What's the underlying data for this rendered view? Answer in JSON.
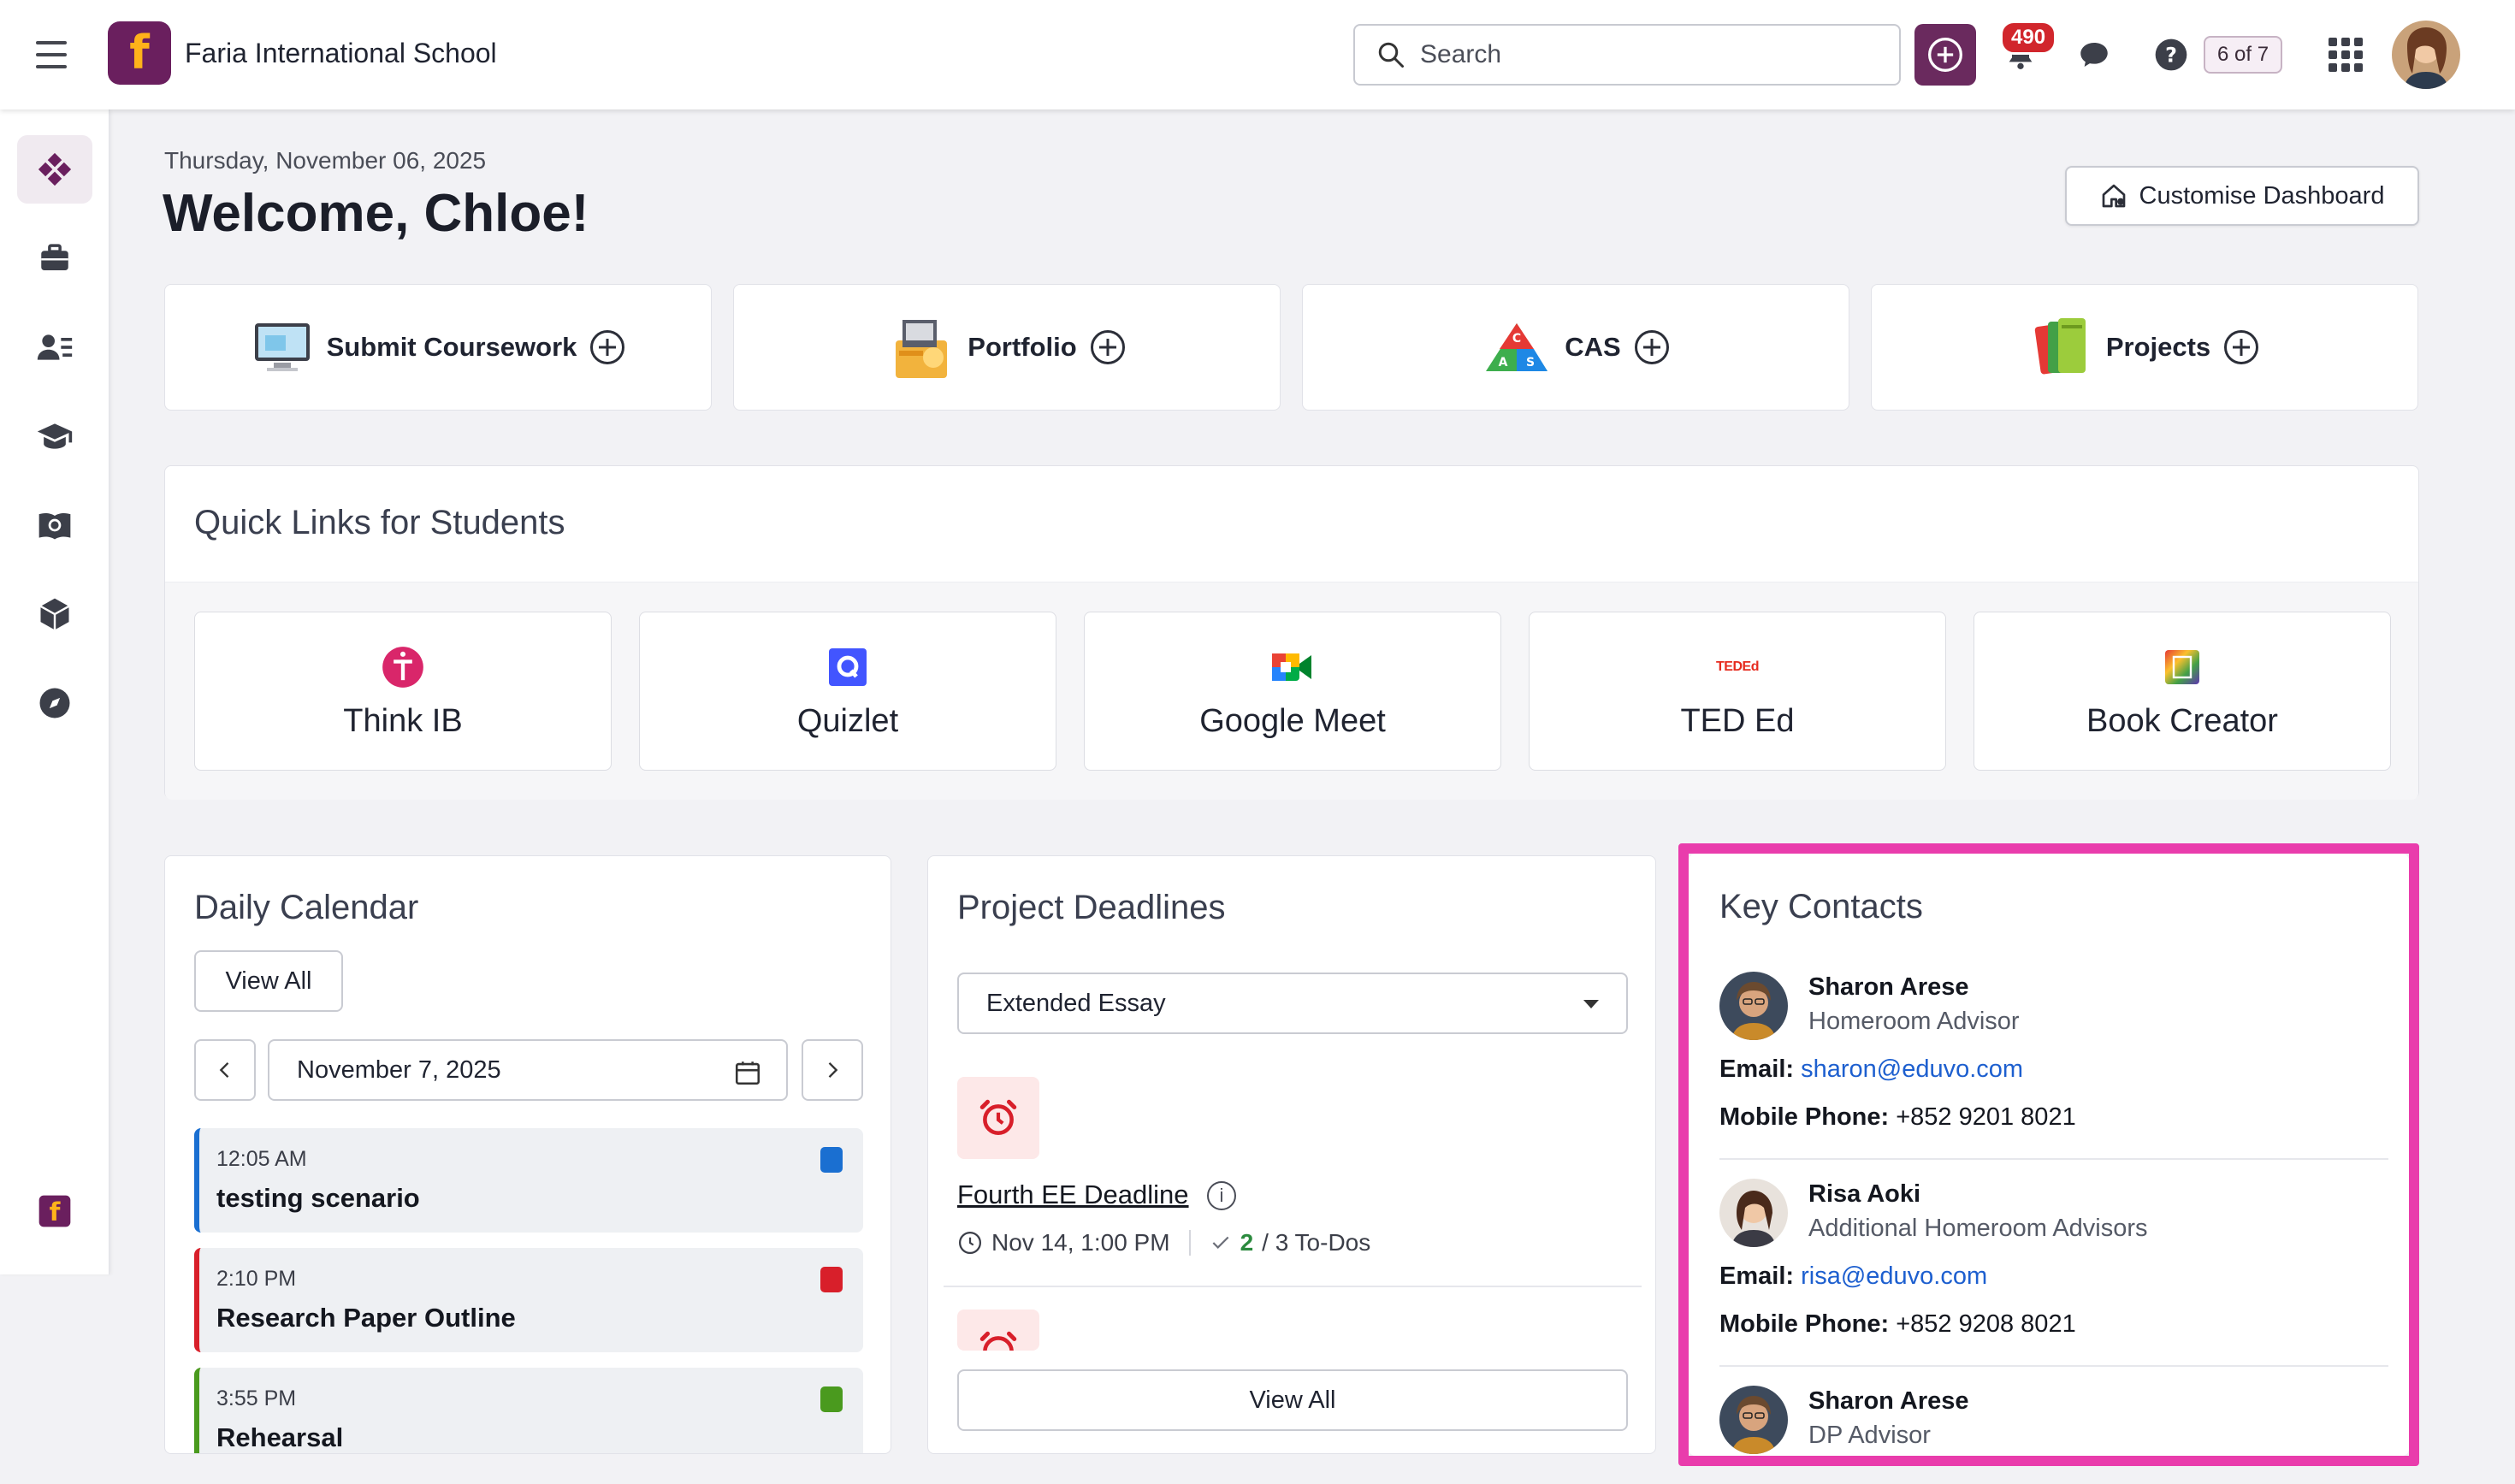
{
  "header": {
    "school_name": "Faria International School",
    "logo_letter": "f",
    "search_placeholder": "Search",
    "notification_count": "490",
    "pager": "6 of 7"
  },
  "dashboard": {
    "date": "Thursday, November 06, 2025",
    "welcome": "Welcome, Chloe!",
    "customise_label": "Customise Dashboard"
  },
  "actions": [
    {
      "label": "Submit Coursework",
      "icon": "monitor-icon"
    },
    {
      "label": "Portfolio",
      "icon": "portfolio-icon"
    },
    {
      "label": "CAS",
      "icon": "cas-triangle-icon"
    },
    {
      "label": "Projects",
      "icon": "notebooks-icon"
    }
  ],
  "quick_links": {
    "title": "Quick Links for Students",
    "items": [
      {
        "label": "Think IB",
        "icon": "think-ib-icon"
      },
      {
        "label": "Quizlet",
        "icon": "quizlet-icon"
      },
      {
        "label": "Google Meet",
        "icon": "google-meet-icon"
      },
      {
        "label": "TED Ed",
        "icon": "ted-ed-icon",
        "icon_text": "TEDEd"
      },
      {
        "label": "Book Creator",
        "icon": "book-creator-icon"
      }
    ]
  },
  "daily_calendar": {
    "title": "Daily Calendar",
    "view_all": "View All",
    "date": "November 7, 2025",
    "events": [
      {
        "time": "12:05 AM",
        "title": "testing scenario",
        "color": "#1a6fd1"
      },
      {
        "time": "2:10 PM",
        "title": "Research Paper Outline",
        "color": "#d81f2a"
      },
      {
        "time": "3:55 PM",
        "title": "Rehearsal",
        "color": "#4a9a1e"
      }
    ]
  },
  "project_deadlines": {
    "title": "Project Deadlines",
    "selected": "Extended Essay",
    "deadline_title": "Fourth EE Deadline",
    "deadline_date": "Nov 14, 1:00 PM",
    "todos_done": "2",
    "todos_total": "/ 3 To-Dos",
    "view_all": "View All"
  },
  "key_contacts": {
    "title": "Key Contacts",
    "email_label": "Email:",
    "phone_label": "Mobile Phone:",
    "contacts": [
      {
        "name": "Sharon Arese",
        "role": "Homeroom Advisor",
        "email": "sharon@eduvo.com",
        "phone": "+852 9201 8021"
      },
      {
        "name": "Risa Aoki",
        "role": "Additional Homeroom Advisors",
        "email": "risa@eduvo.com",
        "phone": "+852 9208 8021"
      },
      {
        "name": "Sharon Arese",
        "role": "DP Advisor"
      }
    ]
  },
  "colors": {
    "brand": "#6a1f5e",
    "highlight": "#e93cac",
    "link": "#1d5fcf"
  }
}
